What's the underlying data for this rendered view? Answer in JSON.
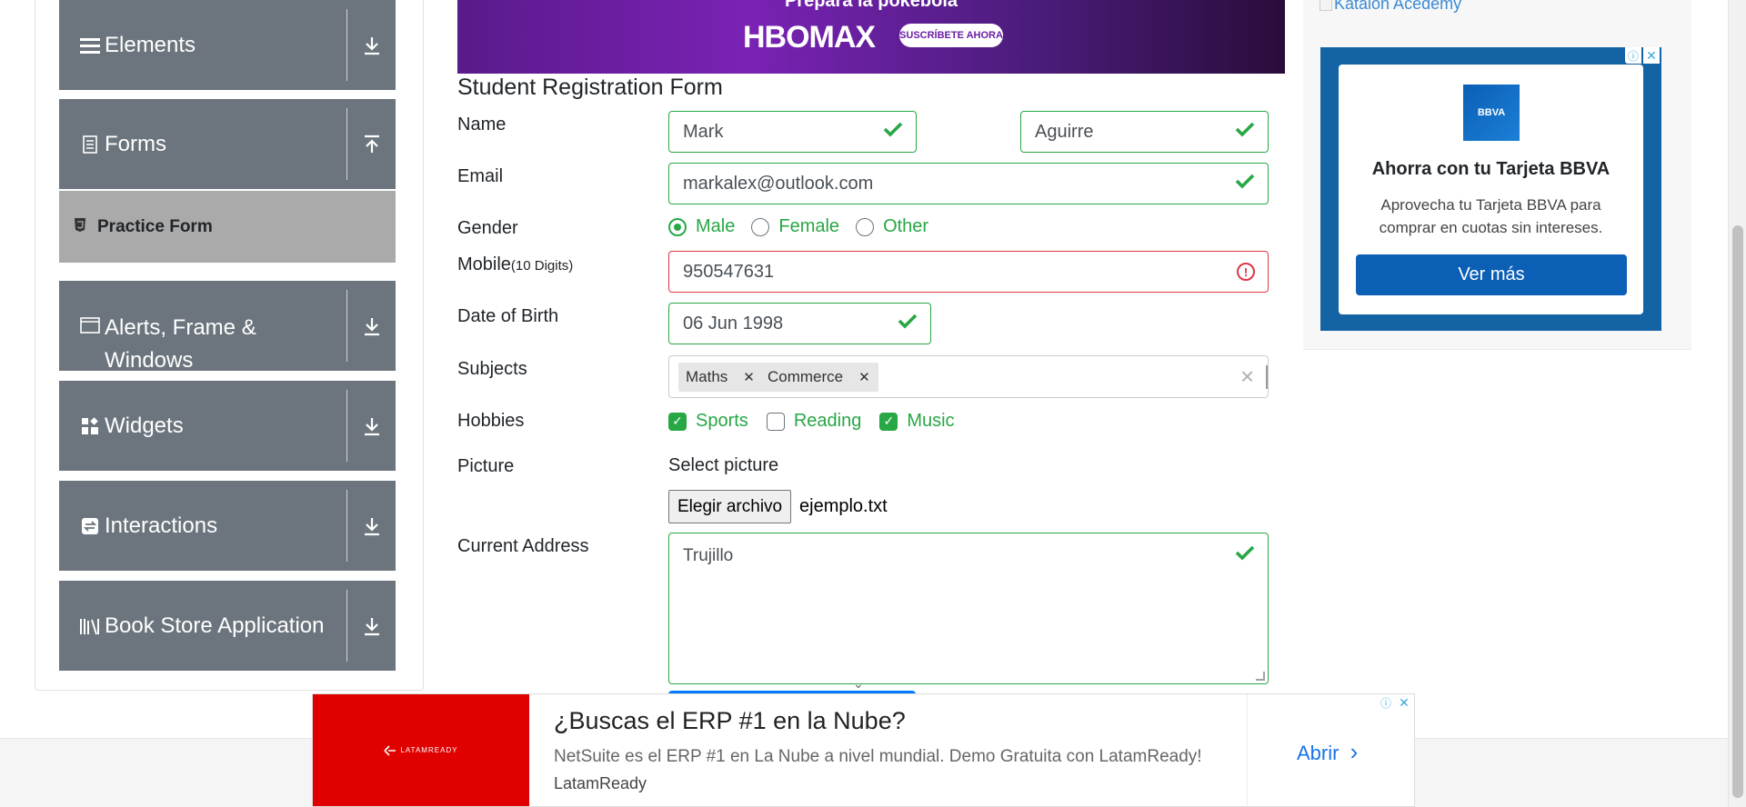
{
  "sidebar": {
    "groups": [
      {
        "label": "Elements",
        "icon": "list-icon",
        "arrow": "download-arrow"
      },
      {
        "label": "Forms",
        "icon": "document-icon",
        "arrow": "upload-arrow"
      },
      {
        "label": "Alerts, Frame & Windows",
        "icon": "window-icon",
        "arrow": "download-arrow"
      },
      {
        "label": "Widgets",
        "icon": "widgets-icon",
        "arrow": "download-arrow"
      },
      {
        "label": "Interactions",
        "icon": "interactions-icon",
        "arrow": "download-arrow"
      },
      {
        "label": "Book Store Application",
        "icon": "books-icon",
        "arrow": "download-arrow"
      }
    ],
    "active_item": "Practice Form"
  },
  "top_ad": {
    "line1": "Prepara la pokebola",
    "brand": "HBOMAX",
    "cta": "SUSCRÍBETE AHORA"
  },
  "form": {
    "title": "Student Registration Form",
    "labels": {
      "name": "Name",
      "email": "Email",
      "gender": "Gender",
      "mobile": "Mobile",
      "mobile_hint": "(10 Digits)",
      "dob": "Date of Birth",
      "subjects": "Subjects",
      "hobbies": "Hobbies",
      "picture": "Picture",
      "address": "Current Address"
    },
    "first_name": "Mark",
    "last_name": "Aguirre",
    "email": "markalex@outlook.com",
    "gender_options": [
      "Male",
      "Female",
      "Other"
    ],
    "gender_selected": "Male",
    "mobile": "950547631",
    "dob": "06 Jun 1998",
    "subjects": [
      "Maths",
      "Commerce"
    ],
    "hobbies": [
      {
        "label": "Sports",
        "checked": true
      },
      {
        "label": "Reading",
        "checked": false
      },
      {
        "label": "Music",
        "checked": true
      }
    ],
    "select_picture": "Select picture",
    "file_button": "Elegir archivo",
    "file_name": "ejemplo.txt",
    "current_address": "Trujillo"
  },
  "right_ad": {
    "link": "Katalon Acedemy",
    "logo": "BBVA",
    "heading": "Ahorra con tu Tarjeta BBVA",
    "body": "Aprovecha tu Tarjeta BBVA para comprar en cuotas sin intereses.",
    "button": "Ver más"
  },
  "bottom_ad": {
    "logo_text": "LATAMREADY",
    "headline": "¿Buscas el ERP #1 en la Nube?",
    "description": "NetSuite es el ERP #1 en La Nube a nivel mundial. Demo Gratuita con LatamReady!",
    "brand": "LatamReady",
    "cta": "Abrir"
  },
  "colors": {
    "valid": "#28a745",
    "invalid": "#dc3545",
    "sidebar_bg": "#6c757d",
    "active_item_bg": "#aaaaaa"
  }
}
